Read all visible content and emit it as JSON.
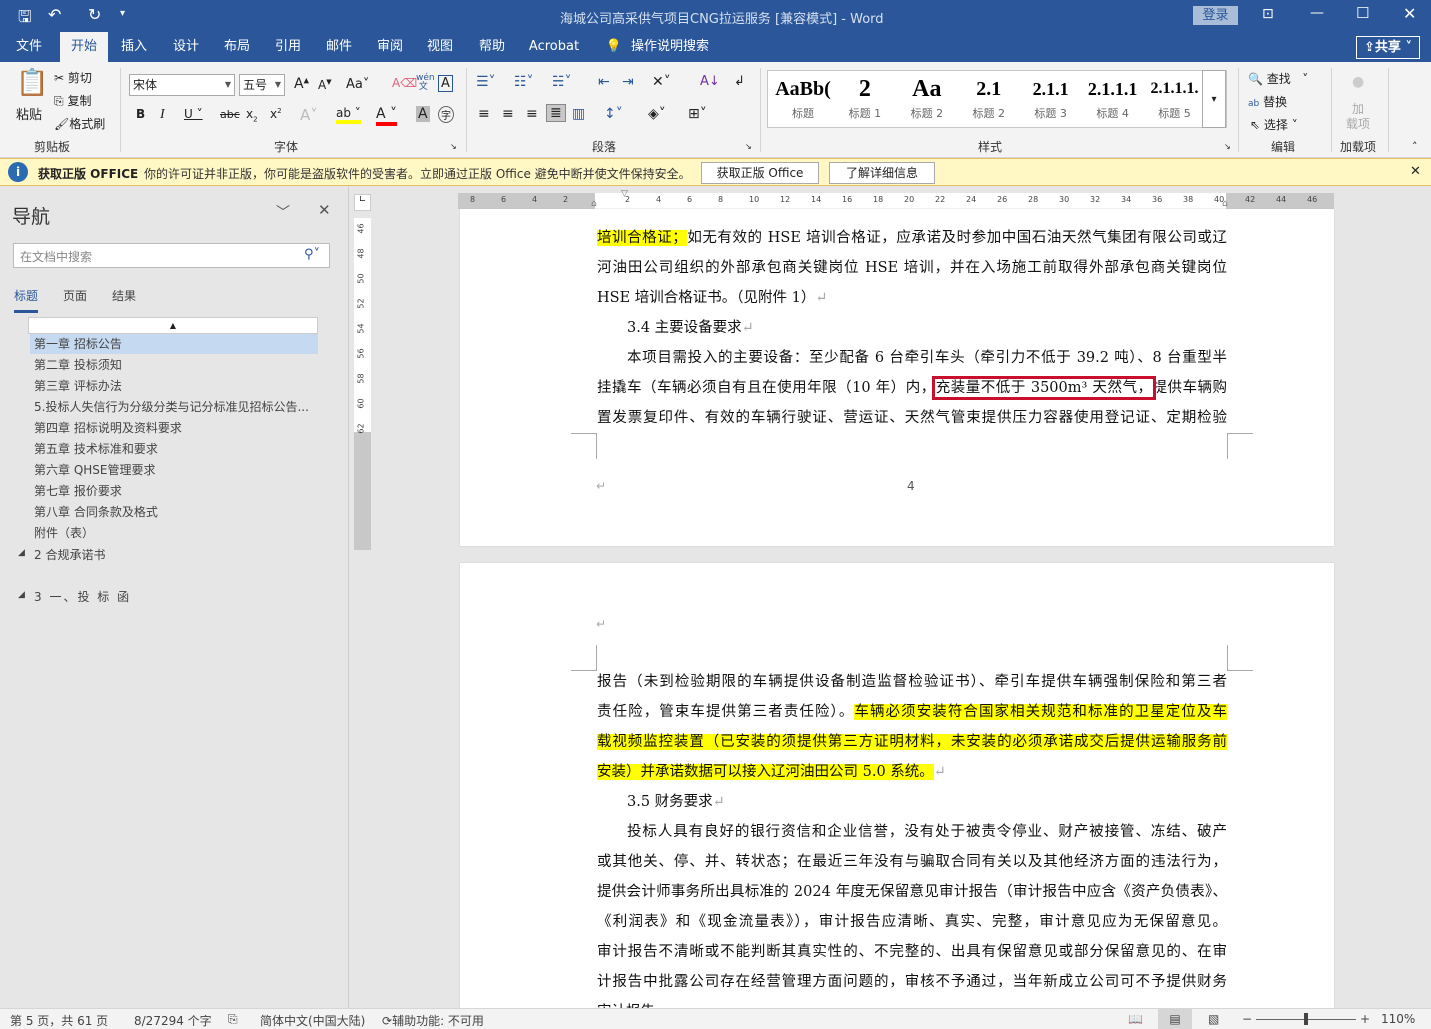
{
  "title": {
    "doc": "海城公司高采供气项目CNG拉运服务 [兼容模式]  -  Word",
    "login": "登录"
  },
  "tabs": [
    "文件",
    "开始",
    "插入",
    "设计",
    "布局",
    "引用",
    "邮件",
    "审阅",
    "视图",
    "帮助",
    "Acrobat"
  ],
  "tell_me": "操作说明搜索",
  "share": "共享",
  "ribbon": {
    "clipboard": {
      "paste": "粘贴",
      "cut": "剪切",
      "copy": "复制",
      "format_painter": "格式刷",
      "label": "剪贴板"
    },
    "font": {
      "name": "宋体",
      "size": "五号",
      "label": "字体",
      "phonetic": "wén"
    },
    "paragraph": {
      "label": "段落"
    },
    "styles": {
      "label": "样式",
      "items": [
        {
          "preview": "AaBb(",
          "name": "标题"
        },
        {
          "preview": "2",
          "name": "标题 1"
        },
        {
          "preview": "Aa",
          "name": "标题 2"
        },
        {
          "preview": "2.1",
          "name": "标题 2"
        },
        {
          "preview": "2.1.1",
          "name": "标题 3"
        },
        {
          "preview": "2.1.1.1",
          "name": "标题 4"
        },
        {
          "preview": "2.1.1.1.",
          "name": "标题 5"
        }
      ]
    },
    "editing": {
      "find": "查找",
      "replace": "替换",
      "select": "选择",
      "label": "编辑"
    },
    "addins": {
      "button": "加\n载项",
      "label": "加载项"
    }
  },
  "warning": {
    "title": "获取正版 OFFICE",
    "message": "你的许可证并非正版，你可能是盗版软件的受害者。立即通过正版 Office 避免中断并使文件保持安全。",
    "btn1": "获取正版 Office",
    "btn2": "了解详细信息"
  },
  "nav": {
    "title": "导航",
    "search_placeholder": "在文档中搜索",
    "tabs": [
      "标题",
      "页面",
      "结果"
    ],
    "items": [
      "第一章  招标公告",
      "第二章  投标须知",
      "第三章  评标办法",
      "5.投标人失信行为分级分类与记分标准见招标公告...",
      "第四章  招标说明及资料要求",
      "第五章  技术标准和要求",
      "第六章  QHSE管理要求",
      "第七章  报价要求",
      "第八章  合同条款及格式",
      "附件（表）"
    ],
    "sections": [
      "2 合规承诺书",
      "3 一、投 标 函"
    ]
  },
  "rulers": {
    "h": [
      "8",
      "6",
      "4",
      "2",
      "",
      "2",
      "4",
      "6",
      "8",
      "10",
      "12",
      "14",
      "16",
      "18",
      "20",
      "22",
      "24",
      "26",
      "28",
      "30",
      "32",
      "34",
      "36",
      "38",
      "40",
      "42",
      "44",
      "46"
    ],
    "v": [
      "46",
      "48",
      "50",
      "52",
      "54",
      "56",
      "58",
      "60",
      "62"
    ]
  },
  "page1": {
    "lines": [
      {
        "cls": "j",
        "segs": [
          {
            "t": "培训合格证；",
            "hl": true
          },
          {
            "t": "如无有效的 HSE 培训合格证，应承诺及时参加中国石油天然气集团有限公司或辽"
          }
        ]
      },
      {
        "cls": "j",
        "segs": [
          {
            "t": "河油田公司组织的外部承包商关键岗位 HSE 培训，并在入场施工前取得外部承包商关键岗位"
          }
        ]
      },
      {
        "cls": "",
        "segs": [
          {
            "t": "HSE 培训合格证书。（见附件 1）"
          },
          {
            "t": "↵",
            "pm": true
          }
        ]
      },
      {
        "cls": "ind",
        "segs": [
          {
            "t": "3.4 主要设备要求"
          },
          {
            "t": "↵",
            "pm": true
          }
        ]
      },
      {
        "cls": "j ind",
        "segs": [
          {
            "t": "本项目需投入的主要设备：至少配备 6 台牵引车头（牵引力不低于 39.2 吨）、8 台重型半"
          }
        ]
      },
      {
        "cls": "j",
        "segs": [
          {
            "t": "挂撬车（车辆必须自有且在使用年限（10 年）内，"
          },
          {
            "t": "充装量不低于 3500m³ 天然气，",
            "box": true
          },
          {
            "t": "提供车辆购"
          }
        ]
      },
      {
        "cls": "j",
        "segs": [
          {
            "t": "置发票复印件、有效的车辆行驶证、营运证、天然气管束提供压力容器使用登记证、定期检验"
          }
        ]
      }
    ],
    "footer_mark": "↵",
    "page_number": "4"
  },
  "page2": {
    "header_mark": "↵",
    "lines": [
      {
        "cls": "j",
        "segs": [
          {
            "t": "报告（未到检验期限的车辆提供设备制造监督检验证书）、牵引车提供车辆强制保险和第三者"
          }
        ]
      },
      {
        "cls": "j",
        "segs": [
          {
            "t": "责任险，管束车提供第三者责任险）。"
          },
          {
            "t": "车辆必须安装符合国家相关规范和标准的卫星定位及车",
            "hl": true
          }
        ]
      },
      {
        "cls": "j",
        "segs": [
          {
            "t": "载视频监控装置（已安装的须提供第三方证明材料，未安装的必须承诺成交后提供运输服务前",
            "hl": true
          }
        ]
      },
      {
        "cls": "",
        "segs": [
          {
            "t": "安装）并承诺数据可以接入辽河油田公司 5.0 系统。",
            "hl": true
          },
          {
            "t": "↵",
            "pm": true
          }
        ]
      },
      {
        "cls": "ind",
        "segs": [
          {
            "t": "3.5 财务要求"
          },
          {
            "t": "↵",
            "pm": true
          }
        ]
      },
      {
        "cls": "j ind",
        "segs": [
          {
            "t": "投标人具有良好的银行资信和企业信誉，没有处于被责令停业、财产被接管、冻结、破产"
          }
        ]
      },
      {
        "cls": "j",
        "segs": [
          {
            "t": "或其他关、停、并、转状态；在最近三年没有与骗取合同有关以及其他经济方面的违法行为，"
          }
        ]
      },
      {
        "cls": "j",
        "segs": [
          {
            "t": "提供会计师事务所出具标准的 2024 年度无保留意见审计报告（审计报告中应含《资产负债表》、"
          }
        ]
      },
      {
        "cls": "j",
        "segs": [
          {
            "t": "《利润表》和《现金流量表》），审计报告应清晰、真实、完整，审计意见应为无保留意见。"
          }
        ]
      },
      {
        "cls": "j",
        "segs": [
          {
            "t": "审计报告不清晰或不能判断其真实性的、不完整的、出具有保留意见或部分保留意见的、在审"
          }
        ]
      },
      {
        "cls": "j",
        "segs": [
          {
            "t": "计报告中批露公司存在经营管理方面问题的，审核不予通过，当年新成立公司可不予提供财务"
          }
        ]
      },
      {
        "cls": "",
        "segs": [
          {
            "t": "审计报告"
          }
        ]
      }
    ]
  },
  "status": {
    "page": "第 5 页，共 61 页",
    "words": "8/27294 个字",
    "lang": "简体中文(中国大陆)",
    "accessibility": "辅助功能: 不可用",
    "zoom": "110%"
  },
  "colors": {
    "brand": "#2b579a",
    "highlight": "#ffff00",
    "box": "#c8102e"
  }
}
